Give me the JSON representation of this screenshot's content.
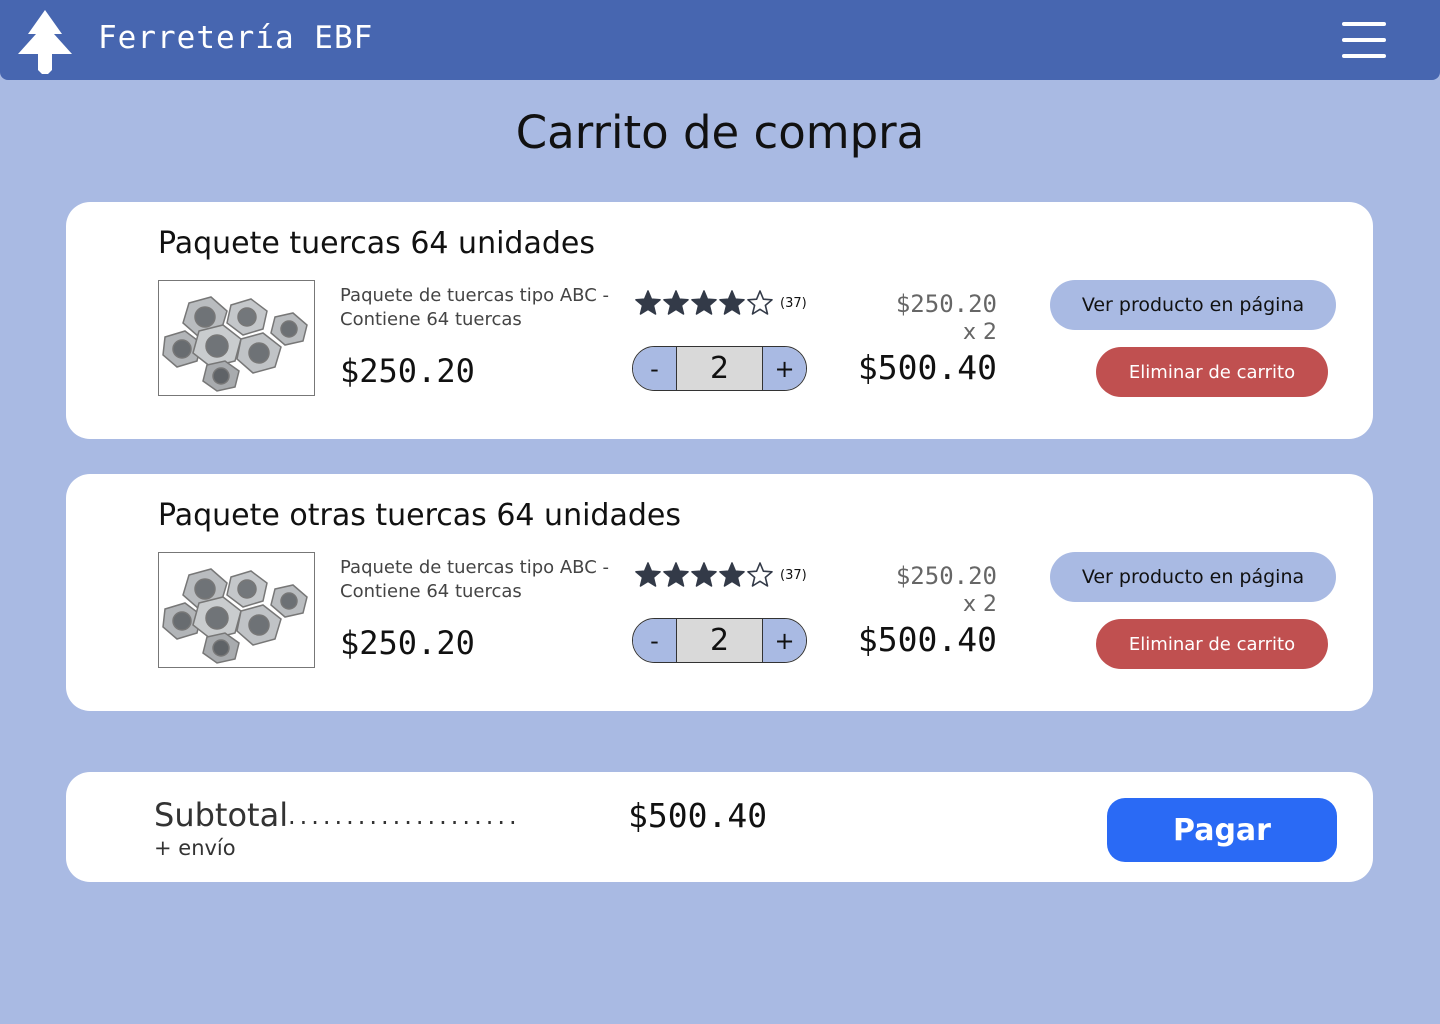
{
  "header": {
    "brand": "Ferretería EBF",
    "logo_icon": "tree-icon",
    "menu_icon": "hamburger-menu-icon"
  },
  "page": {
    "title": "Carrito de compra"
  },
  "cart": {
    "items": [
      {
        "name": "Paquete tuercas 64 unidades",
        "image_icon": "nuts-photo",
        "description": "Paquete de tuercas tipo ABC - Contiene 64 tuercas",
        "price": "$250.20",
        "rating": 4,
        "rating_max": 5,
        "review_count": "(37)",
        "quantity": "2",
        "minus_label": "-",
        "plus_label": "+",
        "unit_price": "$250.20",
        "times": "x 2",
        "line_total": "$500.40",
        "view_label": "Ver producto en página",
        "remove_label": "Eliminar de carrito"
      },
      {
        "name": "Paquete otras tuercas 64 unidades",
        "image_icon": "nuts-photo",
        "description": "Paquete de tuercas tipo ABC - Contiene 64 tuercas",
        "price": "$250.20",
        "rating": 4,
        "rating_max": 5,
        "review_count": "(37)",
        "quantity": "2",
        "minus_label": "-",
        "plus_label": "+",
        "unit_price": "$250.20",
        "times": "x 2",
        "line_total": "$500.40",
        "view_label": "Ver producto en página",
        "remove_label": "Eliminar de carrito"
      }
    ]
  },
  "summary": {
    "subtotal_label": "Subtotal",
    "dots": "....................",
    "subtotal_value": "$500.40",
    "shipping_note": "+ envío",
    "pay_label": "Pagar"
  },
  "colors": {
    "background": "#a9bae3",
    "header": "#4766b0",
    "remove_button": "#c05050",
    "pay_button": "#2a6af5",
    "star": "#333a48"
  }
}
